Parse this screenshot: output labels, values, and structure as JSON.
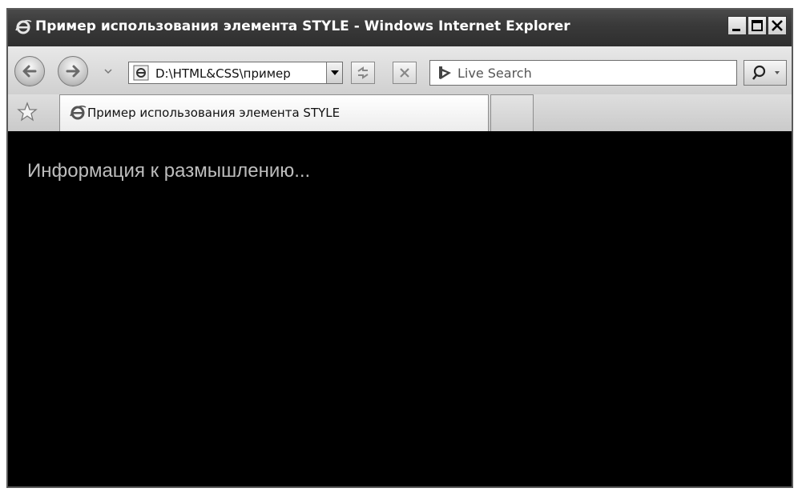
{
  "window": {
    "title": "Пример использования элемента STYLE - Windows Internet Explorer"
  },
  "address_bar": {
    "url": "D:\\HTML&CSS\\пример"
  },
  "search": {
    "placeholder": "Live Search"
  },
  "tabs": [
    {
      "label": "Пример использования элемента STYLE"
    }
  ],
  "page": {
    "text": "Информация к размышлению..."
  },
  "icons": {
    "title": "ie-logo-icon",
    "back": "back-arrow-icon",
    "forward": "forward-arrow-icon",
    "refresh": "refresh-icon",
    "stop": "stop-icon",
    "search_provider": "live-search-logo-icon",
    "search": "magnifier-icon",
    "favorites": "star-icon"
  }
}
